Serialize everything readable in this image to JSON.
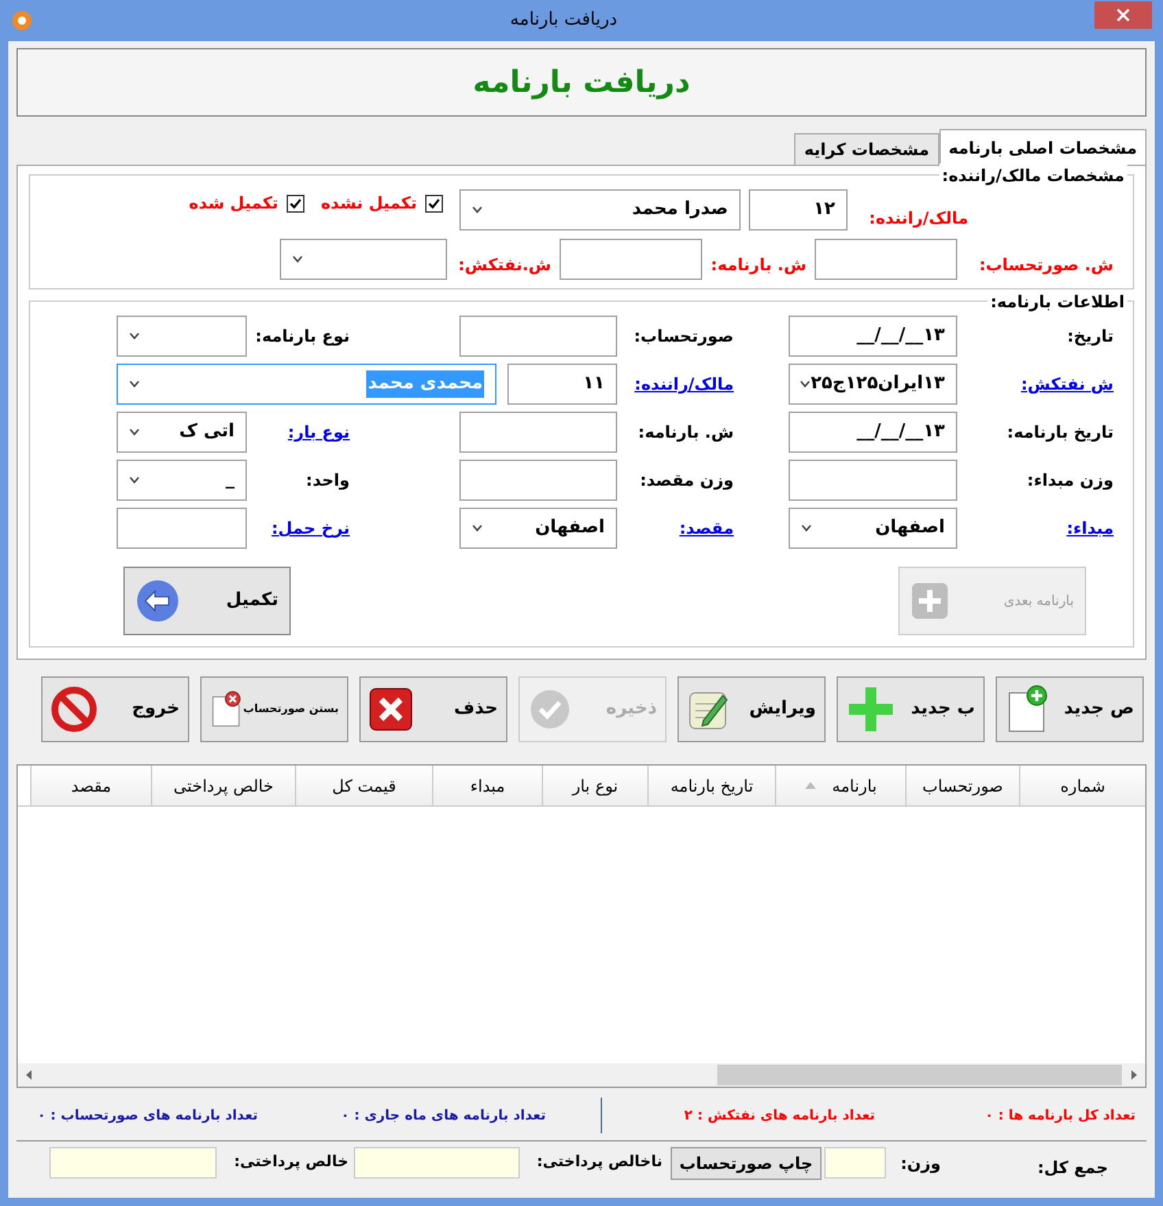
{
  "window": {
    "title": "دریافت بارنامه"
  },
  "header": "دریافت بارنامه",
  "tabs": [
    {
      "label": "مشخصات اصلی بارنامه",
      "selected": true
    },
    {
      "label": "مشخصات کرایه",
      "selected": false
    }
  ],
  "owner_section": {
    "title": "مشخصات مالک/راننده:",
    "owner_label": "مالک/راننده:",
    "owner_code": "۱۲",
    "owner_name": "صدرا محمد",
    "checkboxes": [
      {
        "label": "تکمیل نشده",
        "checked": true
      },
      {
        "label": "تکمیل شده",
        "checked": true
      }
    ],
    "row2": [
      {
        "label": "ش. صورتحساب:",
        "kind": "text"
      },
      {
        "label": "ش. بارنامه:",
        "kind": "text"
      },
      {
        "label": "ش.نفتکش:",
        "kind": "combo"
      }
    ]
  },
  "info_section": {
    "title": "اطلاعات بارنامه:",
    "rows": [
      [
        {
          "label": "تاریخ:",
          "link": false,
          "controls": [
            {
              "kind": "text",
              "value": "۱۳__/__/__"
            }
          ]
        },
        {
          "label": "صورتحساب:",
          "link": false,
          "controls": [
            {
              "kind": "text"
            }
          ]
        },
        {
          "label": "نوع بارنامه:",
          "link": false,
          "controls": [
            {
              "kind": "combo"
            }
          ]
        }
      ],
      [
        {
          "label": "ش نفتکش:",
          "link": true,
          "controls": [
            {
              "kind": "combo",
              "value": "۱۳ایران۱۲۵ج۲۵"
            }
          ]
        },
        {
          "label": "مالک/راننده:",
          "link": true,
          "controls": [
            {
              "kind": "text",
              "value": "۱۱"
            },
            {
              "kind": "combo",
              "value": "محمدی محمد",
              "text_selected": true
            }
          ]
        }
      ],
      [
        {
          "label": "تاریخ بارنامه:",
          "link": false,
          "controls": [
            {
              "kind": "text",
              "value": "۱۳__/__/__"
            }
          ]
        },
        {
          "label": "ش. بارنامه:",
          "link": false,
          "controls": [
            {
              "kind": "text"
            }
          ]
        },
        {
          "label": "نوع بار:",
          "link": true,
          "controls": [
            {
              "kind": "combo",
              "value": "اتی ک"
            }
          ]
        }
      ],
      [
        {
          "label": "وزن مبداء:",
          "link": false,
          "controls": [
            {
              "kind": "text"
            }
          ]
        },
        {
          "label": "وزن مقصد:",
          "link": false,
          "controls": [
            {
              "kind": "text"
            }
          ]
        },
        {
          "label": "واحد:",
          "link": false,
          "controls": [
            {
              "kind": "combo",
              "value": "_"
            }
          ]
        }
      ],
      [
        {
          "label": "مبداء:",
          "link": true,
          "controls": [
            {
              "kind": "combo",
              "value": "اصفهان"
            }
          ]
        },
        {
          "label": "مقصد:",
          "link": true,
          "controls": [
            {
              "kind": "combo",
              "value": "اصفهان"
            }
          ]
        },
        {
          "label": "نرخ حمل:",
          "link": true,
          "controls": [
            {
              "kind": "text"
            }
          ]
        }
      ]
    ],
    "next_button": {
      "label": "بارنامه بعدی",
      "disabled": true
    },
    "complete_button": {
      "label": "تکمیل",
      "disabled": false
    }
  },
  "toolbar": [
    {
      "label": "ص جدید",
      "kind": "new-doc",
      "disabled": false
    },
    {
      "label": "ب جدید",
      "kind": "plus",
      "disabled": false
    },
    {
      "label": "ویرایش",
      "kind": "edit",
      "disabled": false
    },
    {
      "label": "ذخیره",
      "kind": "check",
      "disabled": true
    },
    {
      "label": "حذف",
      "kind": "delete",
      "disabled": false
    },
    {
      "label": "بستن صورتحساب",
      "kind": "close-doc",
      "disabled": false
    },
    {
      "label": "خروج",
      "kind": "exit",
      "disabled": false
    }
  ],
  "table": {
    "columns": [
      {
        "label": "شماره",
        "sorted": false
      },
      {
        "label": "صورتحساب",
        "sorted": false
      },
      {
        "label": "بارنامه",
        "sorted": true
      },
      {
        "label": "تاریخ بارنامه",
        "sorted": false
      },
      {
        "label": "نوع بار",
        "sorted": false
      },
      {
        "label": "مبداء",
        "sorted": false
      },
      {
        "label": "قیمت کل",
        "sorted": false
      },
      {
        "label": "خالص پرداختی",
        "sorted": false
      },
      {
        "label": "مقصد",
        "sorted": false
      }
    ]
  },
  "stats": [
    {
      "text": "تعداد کل بارنامه ها : ۰",
      "color": "#ff0000"
    },
    {
      "text": "تعداد بارنامه های نفتکش : ۲",
      "color": "#ff0000"
    },
    {
      "text": "تعداد بارنامه های ماه جاری : ۰",
      "color": "#1a1aa8"
    },
    {
      "text": "تعداد بارنامه های صورتحساب : ۰",
      "color": "#1a1aa8"
    }
  ],
  "footer": {
    "total_label": "جمع کل:",
    "weight_label": "وزن:",
    "print_button": "چاپ صورتحساب",
    "gross_label": "ناخالص پرداختی:",
    "net_label": "خالص پرداختی:"
  }
}
